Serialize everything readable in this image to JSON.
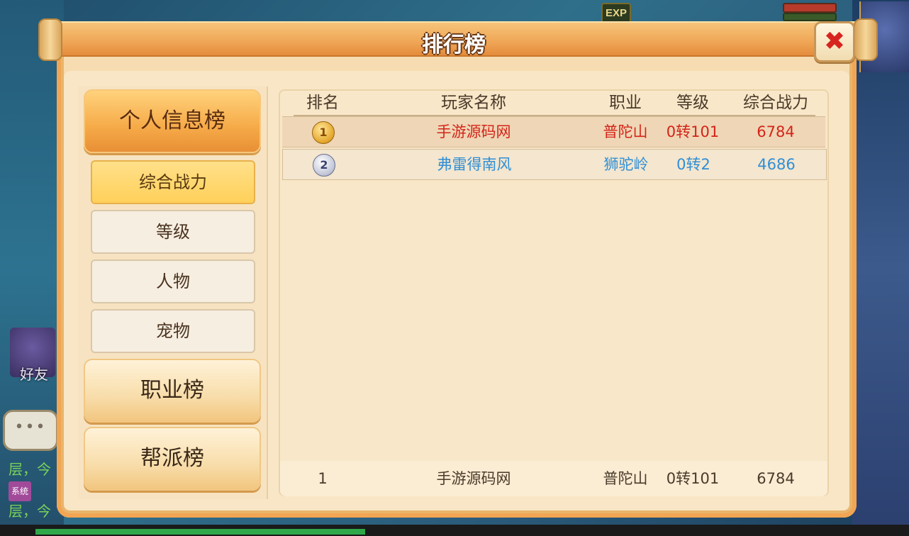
{
  "hud": {
    "exp_label": "EXP",
    "friend_label": "好友",
    "chat_dots": "•••",
    "chat_lines": [
      "层，今",
      "层，今"
    ],
    "system_badge": "系统"
  },
  "window": {
    "title": "排行榜"
  },
  "menu": {
    "categories": [
      {
        "label": "个人信息榜"
      },
      {
        "label": "职业榜"
      },
      {
        "label": "帮派榜"
      }
    ],
    "sub_tabs": [
      {
        "label": "综合战力"
      },
      {
        "label": "等级"
      },
      {
        "label": "人物"
      },
      {
        "label": "宠物"
      }
    ]
  },
  "table": {
    "headers": {
      "rank": "排名",
      "player": "玩家名称",
      "class": "职业",
      "level": "等级",
      "power": "综合战力"
    },
    "rows": [
      {
        "rank": "1",
        "player": "手游源码网",
        "class": "普陀山",
        "level": "0转101",
        "power": "6784",
        "color": "#d42418"
      },
      {
        "rank": "2",
        "player": "弗雷得南风",
        "class": "狮驼岭",
        "level": "0转2",
        "power": "4686",
        "color": "#2f8fd6"
      }
    ],
    "my_rank": {
      "rank": "1",
      "player": "手游源码网",
      "class": "普陀山",
      "level": "0转101",
      "power": "6784"
    }
  },
  "colors": {
    "accent": "#f0a858",
    "panel": "#f8e6c6",
    "rank1_text": "#d42418",
    "rank2_text": "#2f8fd6"
  }
}
